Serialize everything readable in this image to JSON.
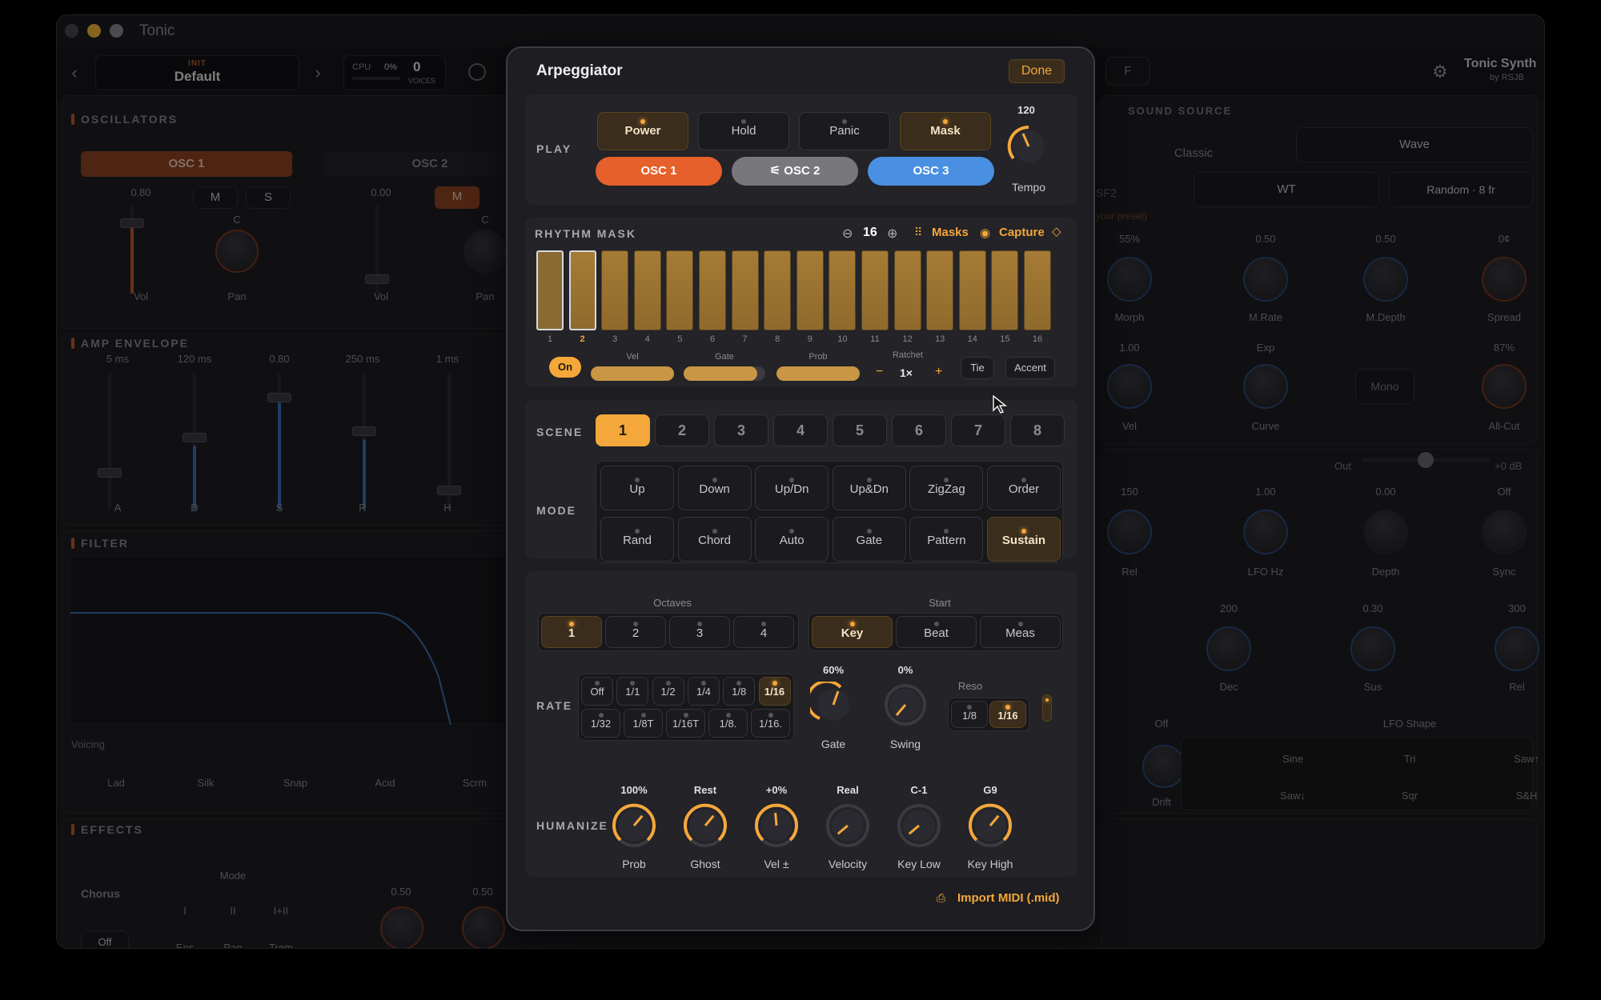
{
  "window": {
    "title": "Tonic"
  },
  "topbar": {
    "preset_category": "INIT",
    "preset_name": "Default",
    "cpu_label": "CPU",
    "cpu_value": "0%",
    "voices_count": "0",
    "voices_label": "VOICES",
    "tab_f": "F",
    "brand": "Tonic Synth",
    "brand_by": "by RSJB"
  },
  "oscillators": {
    "title": "OSCILLATORS",
    "osc1": "OSC 1",
    "osc2": "OSC 2",
    "vol1": "0.80",
    "vol2": "0.00",
    "m": "M",
    "s": "S",
    "pan_val": "C",
    "vol_label": "Vol",
    "pan_label": "Pan"
  },
  "amp_env": {
    "title": "AMP ENVELOPE",
    "values": [
      "5 ms",
      "120 ms",
      "0.80",
      "250 ms",
      "1 ms"
    ],
    "labels": [
      "A",
      "D",
      "S",
      "R",
      "H"
    ]
  },
  "filter": {
    "title": "FILTER",
    "voicing_label": "Voicing",
    "voicing": [
      "Lad",
      "Silk",
      "Snap",
      "Acid",
      "Scrm"
    ]
  },
  "effects": {
    "title": "EFFECTS",
    "chorus": "Chorus",
    "off": "Off",
    "mode_label": "Mode",
    "modes": [
      "I",
      "II",
      "I+II"
    ],
    "modes2": [
      "Ens",
      "Pan",
      "Trem"
    ],
    "k1": "0.50",
    "k2": "0.50"
  },
  "sound_source": {
    "title": "SOUND SOURCE",
    "classic": "Classic",
    "wave": "Wave",
    "sf2": "SF2",
    "wt": "WT",
    "random": "Random · 8 fr",
    "hint": "your preset)",
    "row1_vals": [
      "55%",
      "0.50",
      "0.50",
      "0¢"
    ],
    "row1_labels": [
      "Morph",
      "M.Rate",
      "M.Depth",
      "Spread"
    ],
    "row2_vals": [
      "1.00",
      "Exp",
      "",
      "87%"
    ],
    "row2_labels": [
      "Vel",
      "Curve",
      "Mono",
      "All-Cut"
    ]
  },
  "lfo": {
    "out_label": "Out",
    "out_val": "+0 dB",
    "vals": [
      "150",
      "1.00",
      "0.00",
      "Off"
    ],
    "labels": [
      "Rel",
      "LFO Hz",
      "Depth",
      "Sync"
    ],
    "vals2": [
      "200",
      "0.30",
      "300"
    ],
    "labels2": [
      "Dec",
      "Sus",
      "Rel"
    ],
    "drift_val": "Off",
    "drift": "Drift",
    "shape_label": "LFO Shape",
    "shapes": [
      "Sine",
      "Tri",
      "Saw↑",
      "Saw↓",
      "Sqr",
      "S&H"
    ]
  },
  "arp": {
    "title": "Arpeggiator",
    "done": "Done",
    "play_label": "PLAY",
    "play_buttons": [
      "Power",
      "Hold",
      "Panic",
      "Mask"
    ],
    "osc_buttons": [
      "OSC 1",
      "OSC 2",
      "OSC 3"
    ],
    "osc2_prefix": "⚟",
    "tempo_value": "120",
    "tempo_label": "Tempo",
    "rhythm_title": "RHYTHM MASK",
    "step_count": "16",
    "masks": "Masks",
    "capture": "Capture",
    "steps": [
      "1",
      "2",
      "3",
      "4",
      "5",
      "6",
      "7",
      "8",
      "9",
      "10",
      "11",
      "12",
      "13",
      "14",
      "15",
      "16"
    ],
    "step_on": "On",
    "vel": "Vel",
    "gate": "Gate",
    "prob": "Prob",
    "ratchet": "Ratchet",
    "ratchet_val": "1×",
    "tie": "Tie",
    "accent": "Accent",
    "scene_label": "SCENE",
    "scenes": [
      "1",
      "2",
      "3",
      "4",
      "5",
      "6",
      "7",
      "8"
    ],
    "mode_label": "MODE",
    "modes": [
      "Up",
      "Down",
      "Up/Dn",
      "Up&Dn",
      "ZigZag",
      "Order",
      "Rand",
      "Chord",
      "Auto",
      "Gate",
      "Pattern",
      "Sustain"
    ],
    "octaves_label": "Octaves",
    "octaves": [
      "1",
      "2",
      "3",
      "4"
    ],
    "start_label": "Start",
    "starts": [
      "Key",
      "Beat",
      "Meas"
    ],
    "rate_label": "RATE",
    "rates": [
      "Off",
      "1/1",
      "1/2",
      "1/4",
      "1/8",
      "1/16"
    ],
    "rates2": [
      "1/32",
      "1/8T",
      "1/16T",
      "1/8.",
      "1/16."
    ],
    "gate_val": "60%",
    "gate_label": "Gate",
    "swing_val": "0%",
    "swing_label": "Swing",
    "reso_label": "Reso",
    "resos": [
      "1/8",
      "1/16"
    ],
    "humanize_label": "HUMANIZE",
    "hum_vals": [
      "100%",
      "Rest",
      "+0%",
      "Real",
      "C-1",
      "G9"
    ],
    "hum_labels": [
      "Prob",
      "Ghost",
      "Vel ±",
      "Velocity",
      "Key Low",
      "Key High"
    ],
    "import": "Import MIDI (.mid)"
  },
  "colors": {
    "accent": "#f4a73a",
    "osc1": "#e5602a",
    "osc3": "#4a90e2"
  }
}
